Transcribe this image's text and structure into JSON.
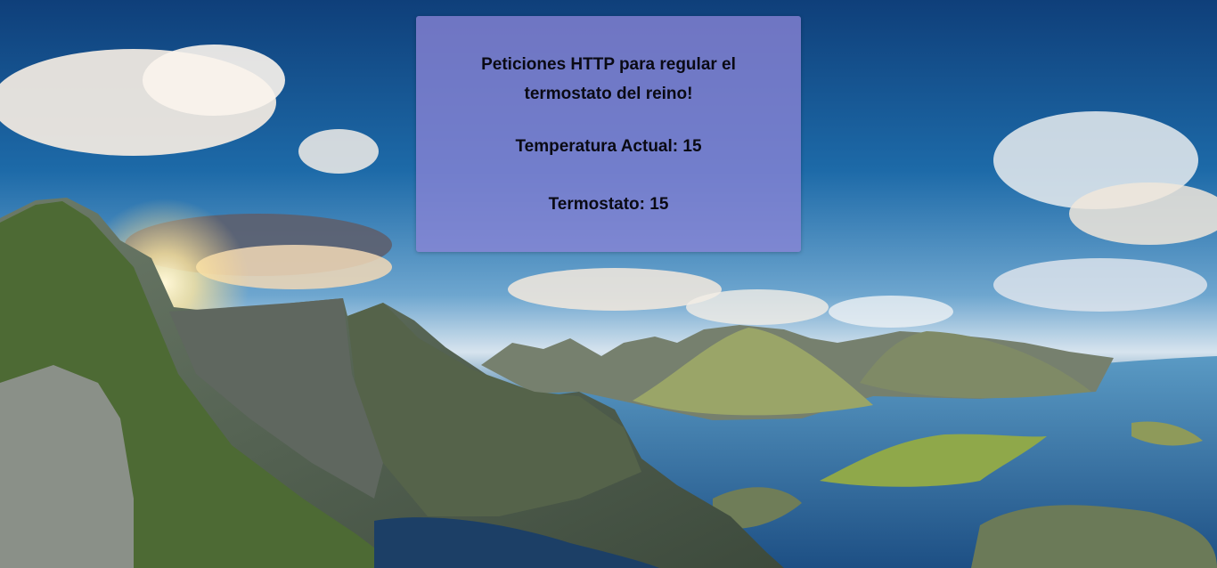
{
  "panel": {
    "title": "Peticiones HTTP para regular el termostato del reino!",
    "temperature_label": "Temperatura Actual:",
    "temperature_value": 15,
    "thermostat_label": "Termostato:",
    "thermostat_value": 15
  }
}
